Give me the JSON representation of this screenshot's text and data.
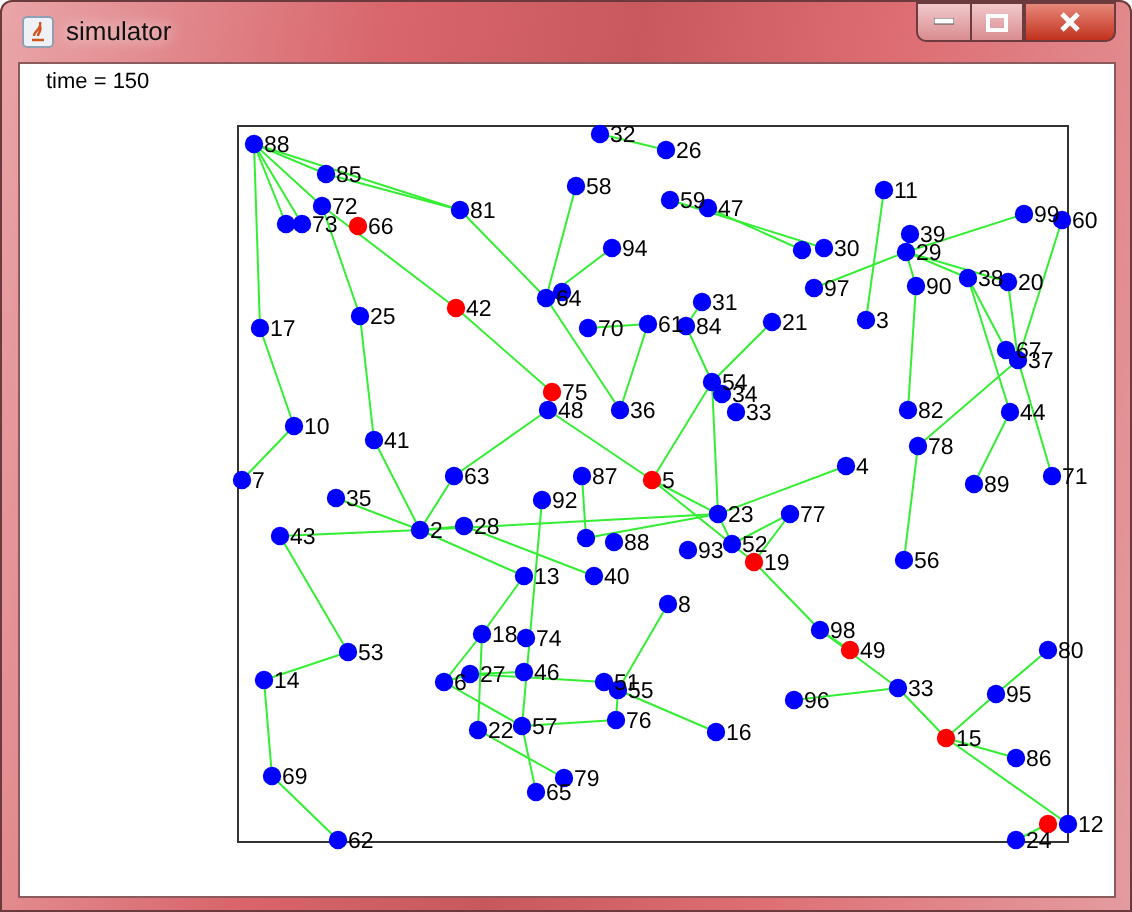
{
  "window": {
    "title": "simulator"
  },
  "status": {
    "time": "time = 150"
  },
  "nodes": [
    {
      "label": "88",
      "color": "#0000ff"
    },
    {
      "label": "85",
      "color": "#0000ff"
    },
    {
      "label": "72",
      "color": "#0000ff"
    },
    {
      "color": "#0000ff"
    },
    {
      "label": "73",
      "color": "#0000ff"
    },
    {
      "label": "66",
      "color": "#ff0000"
    },
    {
      "label": "81",
      "color": "#0000ff"
    },
    {
      "label": "32",
      "color": "#0000ff"
    },
    {
      "label": "26",
      "color": "#0000ff"
    },
    {
      "label": "58",
      "color": "#0000ff"
    },
    {
      "label": "94",
      "color": "#0000ff"
    },
    {
      "color": "#0000ff"
    },
    {
      "label": "64",
      "color": "#0000ff"
    },
    {
      "label": "17",
      "color": "#0000ff"
    },
    {
      "label": "25",
      "color": "#0000ff"
    },
    {
      "label": "42",
      "color": "#ff0000"
    },
    {
      "label": "70",
      "color": "#0000ff"
    },
    {
      "label": "61",
      "color": "#0000ff"
    },
    {
      "label": "59",
      "color": "#0000ff"
    },
    {
      "label": "47",
      "color": "#0000ff"
    },
    {
      "color": "#0000ff"
    },
    {
      "label": "30",
      "color": "#0000ff"
    },
    {
      "label": "11",
      "color": "#0000ff"
    },
    {
      "label": "39",
      "color": "#0000ff"
    },
    {
      "label": "29",
      "color": "#0000ff"
    },
    {
      "label": "99",
      "color": "#0000ff"
    },
    {
      "label": "60",
      "color": "#0000ff"
    },
    {
      "label": "97",
      "color": "#0000ff"
    },
    {
      "label": "90",
      "color": "#0000ff"
    },
    {
      "label": "38",
      "color": "#0000ff"
    },
    {
      "label": "20",
      "color": "#0000ff"
    },
    {
      "label": "31",
      "color": "#0000ff"
    },
    {
      "label": "84",
      "color": "#0000ff"
    },
    {
      "label": "21",
      "color": "#0000ff"
    },
    {
      "label": "3",
      "color": "#0000ff"
    },
    {
      "label": "67",
      "color": "#0000ff"
    },
    {
      "label": "37",
      "color": "#0000ff"
    },
    {
      "label": "10",
      "color": "#0000ff"
    },
    {
      "label": "7",
      "color": "#0000ff"
    },
    {
      "label": "41",
      "color": "#0000ff"
    },
    {
      "label": "75",
      "color": "#ff0000"
    },
    {
      "label": "48",
      "color": "#0000ff"
    },
    {
      "label": "36",
      "color": "#0000ff"
    },
    {
      "label": "63",
      "color": "#0000ff"
    },
    {
      "label": "87",
      "color": "#0000ff"
    },
    {
      "label": "5",
      "color": "#ff0000"
    },
    {
      "label": "35",
      "color": "#0000ff"
    },
    {
      "label": "92",
      "color": "#0000ff"
    },
    {
      "label": "43",
      "color": "#0000ff"
    },
    {
      "label": "2",
      "color": "#0000ff"
    },
    {
      "label": "28",
      "color": "#0000ff"
    },
    {
      "color": "#0000ff"
    },
    {
      "label": "88",
      "color": "#0000ff"
    },
    {
      "label": "13",
      "color": "#0000ff"
    },
    {
      "label": "40",
      "color": "#0000ff"
    },
    {
      "label": "54",
      "color": "#0000ff"
    },
    {
      "label": "34",
      "color": "#0000ff"
    },
    {
      "label": "33",
      "color": "#0000ff"
    },
    {
      "label": "82",
      "color": "#0000ff"
    },
    {
      "label": "44",
      "color": "#0000ff"
    },
    {
      "label": "78",
      "color": "#0000ff"
    },
    {
      "label": "4",
      "color": "#0000ff"
    },
    {
      "label": "89",
      "color": "#0000ff"
    },
    {
      "label": "71",
      "color": "#0000ff"
    },
    {
      "label": "23",
      "color": "#0000ff"
    },
    {
      "label": "77",
      "color": "#0000ff"
    },
    {
      "label": "93",
      "color": "#0000ff"
    },
    {
      "label": "52",
      "color": "#0000ff"
    },
    {
      "label": "19",
      "color": "#ff0000"
    },
    {
      "label": "56",
      "color": "#0000ff"
    },
    {
      "label": "8",
      "color": "#0000ff"
    },
    {
      "label": "98",
      "color": "#0000ff"
    },
    {
      "label": "49",
      "color": "#ff0000"
    },
    {
      "label": "80",
      "color": "#0000ff"
    },
    {
      "label": "18",
      "color": "#0000ff"
    },
    {
      "label": "74",
      "color": "#0000ff"
    },
    {
      "label": "53",
      "color": "#0000ff"
    },
    {
      "label": "14",
      "color": "#0000ff"
    },
    {
      "label": "6",
      "color": "#0000ff"
    },
    {
      "label": "27",
      "color": "#0000ff"
    },
    {
      "label": "46",
      "color": "#0000ff"
    },
    {
      "label": "51",
      "color": "#0000ff"
    },
    {
      "label": "55",
      "color": "#0000ff"
    },
    {
      "label": "33",
      "color": "#0000ff"
    },
    {
      "label": "96",
      "color": "#0000ff"
    },
    {
      "label": "95",
      "color": "#0000ff"
    },
    {
      "label": "22",
      "color": "#0000ff"
    },
    {
      "label": "57",
      "color": "#0000ff"
    },
    {
      "label": "76",
      "color": "#0000ff"
    },
    {
      "label": "16",
      "color": "#0000ff"
    },
    {
      "label": "15",
      "color": "#ff0000"
    },
    {
      "label": "86",
      "color": "#0000ff"
    },
    {
      "label": "69",
      "color": "#0000ff"
    },
    {
      "label": "79",
      "color": "#0000ff"
    },
    {
      "label": "65",
      "color": "#0000ff"
    },
    {
      "label": "62",
      "color": "#0000ff"
    },
    {
      "color": "#ff0000"
    },
    {
      "label": "12",
      "color": "#0000ff"
    },
    {
      "label": "24",
      "color": "#0000ff"
    }
  ]
}
